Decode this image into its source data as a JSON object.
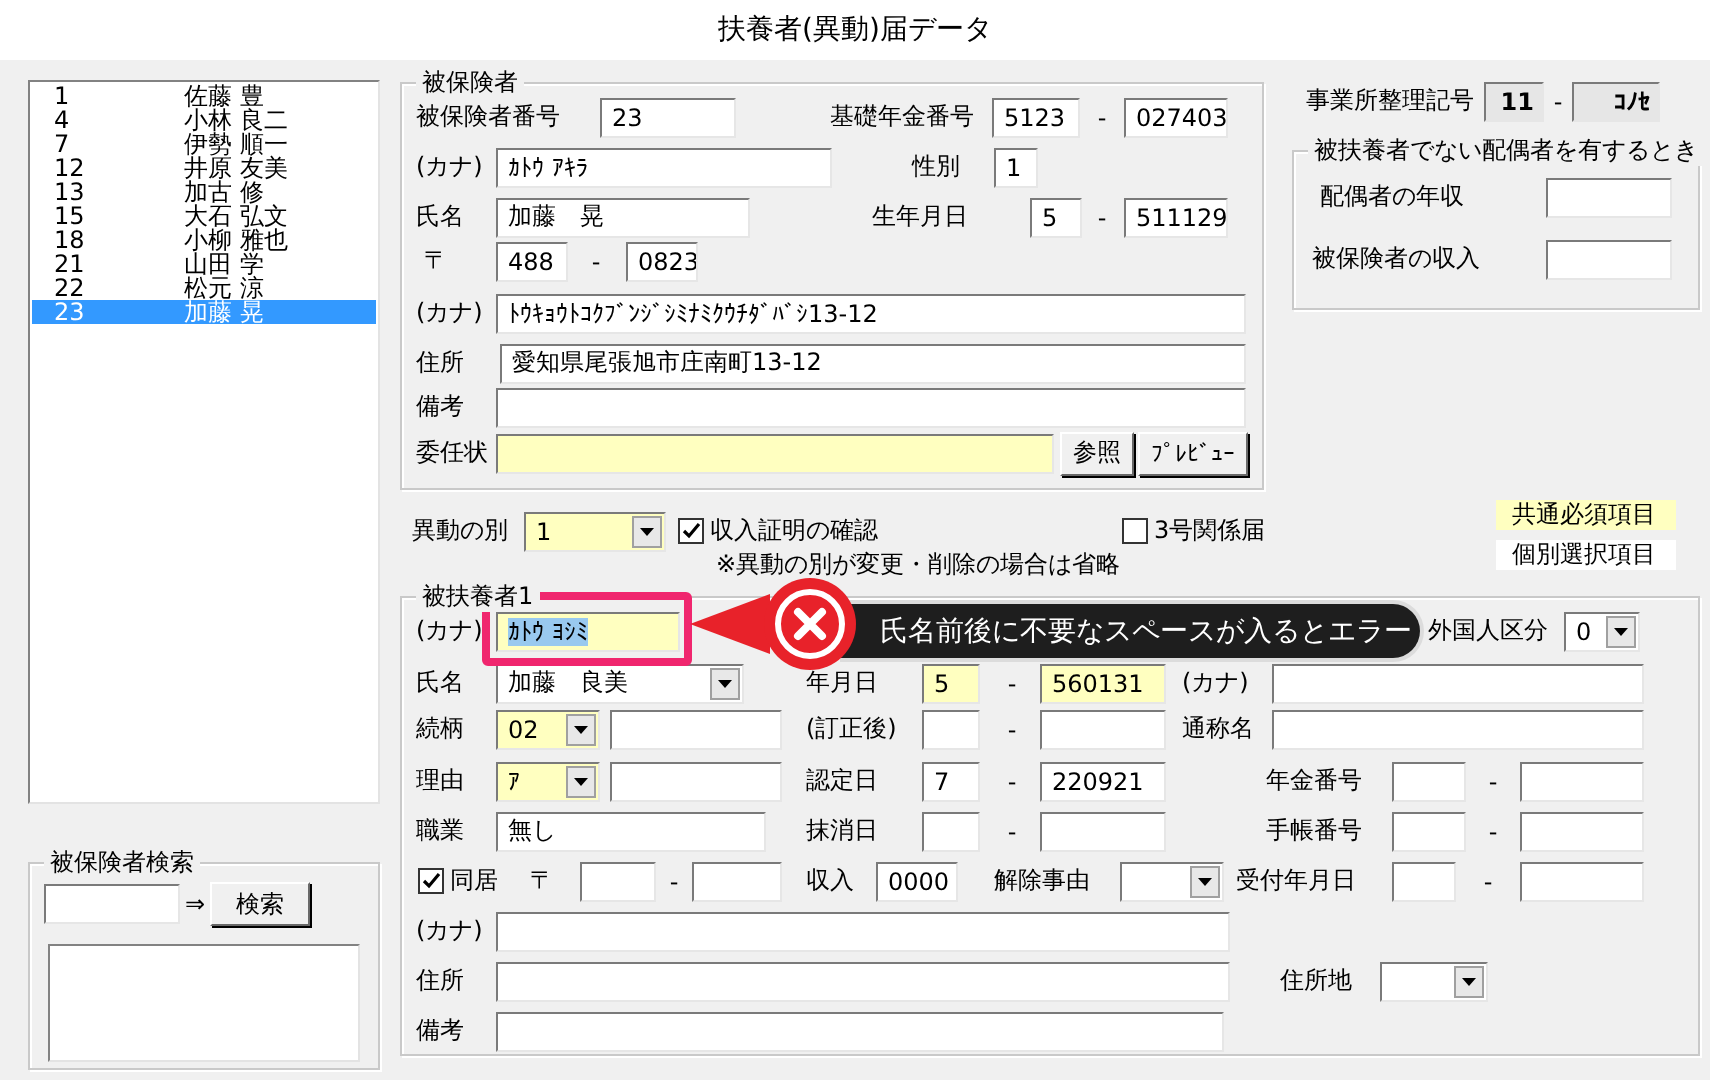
{
  "window": {
    "title": "扶養者(異動)届データ"
  },
  "insured_list": {
    "rows": [
      {
        "number": "1",
        "name": "佐藤 豊",
        "selected": false
      },
      {
        "number": "4",
        "name": "小林 良二",
        "selected": false
      },
      {
        "number": "7",
        "name": "伊勢 順一",
        "selected": false
      },
      {
        "number": "12",
        "name": "井原 友美",
        "selected": false
      },
      {
        "number": "13",
        "name": "加古 修",
        "selected": false
      },
      {
        "number": "15",
        "name": "大石 弘文",
        "selected": false
      },
      {
        "number": "18",
        "name": "小柳 雅也",
        "selected": false
      },
      {
        "number": "21",
        "name": "山田 学",
        "selected": false
      },
      {
        "number": "22",
        "name": "松元 涼",
        "selected": false
      },
      {
        "number": "23",
        "name": "加藤 晃",
        "selected": true
      }
    ]
  },
  "insured_search": {
    "title": "被保険者検索",
    "arrow": "⇒",
    "button": "検索"
  },
  "insured": {
    "title": "被保険者",
    "lines": [
      {
        "items": [
          {
            "kind": "label",
            "text": "被保険者番号"
          },
          {
            "kind": "field",
            "value": "23",
            "required": false
          },
          {
            "kind": "label",
            "text": "基礎年金番号"
          },
          {
            "kind": "field",
            "value": "5123",
            "required": false
          },
          {
            "kind": "sep",
            "text": "-"
          },
          {
            "kind": "field",
            "value": "027403",
            "required": false
          }
        ]
      },
      {
        "items": [
          {
            "kind": "label",
            "text": "(カナ)"
          },
          {
            "kind": "field",
            "value": "ｶﾄｳ ｱｷﾗ",
            "required": false
          },
          {
            "kind": "label",
            "text": "性別"
          },
          {
            "kind": "field",
            "value": "1",
            "required": false
          }
        ]
      },
      {
        "items": [
          {
            "kind": "label",
            "text": "氏名"
          },
          {
            "kind": "field",
            "value": "加藤　晃",
            "required": false
          },
          {
            "kind": "label",
            "text": "生年月日"
          },
          {
            "kind": "field",
            "value": "5",
            "required": false
          },
          {
            "kind": "sep",
            "text": "-"
          },
          {
            "kind": "field",
            "value": "511129",
            "required": false
          }
        ]
      },
      {
        "items": [
          {
            "kind": "label",
            "text": "〒"
          },
          {
            "kind": "field",
            "value": "488",
            "required": false
          },
          {
            "kind": "sep",
            "text": "-"
          },
          {
            "kind": "field",
            "value": "0823",
            "required": false
          }
        ]
      },
      {
        "items": [
          {
            "kind": "label",
            "text": "(カナ)"
          },
          {
            "kind": "field",
            "value": "ﾄｳｷｮｳﾄｺｸﾌﾞﾝｼﾞｼﾐﾅﾐｸｳﾁﾀﾞﾊﾞｼ13-12",
            "required": false
          }
        ]
      },
      {
        "items": [
          {
            "kind": "label",
            "text": "住所"
          },
          {
            "kind": "field",
            "value": "愛知県尾張旭市庄南町13-12",
            "required": false
          }
        ]
      },
      {
        "items": [
          {
            "kind": "label",
            "text": "備考"
          },
          {
            "kind": "field",
            "required": false
          }
        ]
      },
      {
        "items": [
          {
            "kind": "label",
            "text": "委任状"
          },
          {
            "kind": "field",
            "required": true
          },
          {
            "kind": "button",
            "label": "参照"
          },
          {
            "kind": "button",
            "label": "ﾌﾟﾚﾋﾞｭｰ"
          }
        ]
      }
    ]
  },
  "office": {
    "lines": [
      {
        "items": [
          {
            "kind": "label",
            "text": "事業所整理記号"
          },
          {
            "kind": "readonly",
            "value": "11"
          },
          {
            "kind": "sep",
            "text": "-"
          },
          {
            "kind": "readonly",
            "value": "ｺﾉｾ"
          }
        ]
      }
    ]
  },
  "spouse": {
    "title": "被扶養者でない配偶者を有するとき",
    "lines": [
      {
        "items": [
          {
            "kind": "label",
            "text": "配偶者の年収"
          },
          {
            "kind": "field",
            "required": false
          }
        ]
      },
      {
        "items": [
          {
            "kind": "label",
            "text": "被保険者の収入"
          },
          {
            "kind": "field",
            "required": false
          }
        ]
      }
    ]
  },
  "legend": [
    {
      "label": "共通必須項目",
      "required": true
    },
    {
      "label": "個別選択項目",
      "required": false
    }
  ],
  "change": {
    "lines": [
      {
        "items": [
          {
            "kind": "label",
            "text": "異動の別"
          },
          {
            "kind": "combo",
            "value": "1",
            "required": true
          },
          {
            "kind": "check",
            "label": "収入証明の確認",
            "checked": true
          },
          {
            "kind": "check",
            "label": "3号関係届",
            "checked": false
          }
        ]
      }
    ],
    "note": "※異動の別が変更・削除の場合は省略"
  },
  "dependent": {
    "title": "被扶養者1",
    "lines": [
      {
        "items": [
          {
            "kind": "label",
            "text": "(カナ)"
          },
          {
            "kind": "field",
            "value": "ｶﾄｳ ﾖｼﾐ",
            "required": true,
            "highlighted": true
          },
          {
            "kind": "label",
            "text": "外国人区分"
          },
          {
            "kind": "combo",
            "value": "0",
            "required": false
          }
        ]
      },
      {
        "items": [
          {
            "kind": "label",
            "text": "氏名"
          },
          {
            "kind": "combo",
            "value": "加藤　良美",
            "required": false
          },
          {
            "kind": "label",
            "text": "年月日"
          },
          {
            "kind": "field",
            "value": "5",
            "required": true
          },
          {
            "kind": "sep",
            "text": "-"
          },
          {
            "kind": "field",
            "value": "560131",
            "required": true
          },
          {
            "kind": "label",
            "text": "(カナ)"
          },
          {
            "kind": "field",
            "required": false
          }
        ]
      },
      {
        "items": [
          {
            "kind": "label",
            "text": "続柄"
          },
          {
            "kind": "combo",
            "value": "02",
            "required": true
          },
          {
            "kind": "field",
            "required": false
          },
          {
            "kind": "label",
            "text": "(訂正後)"
          },
          {
            "kind": "field",
            "required": false
          },
          {
            "kind": "sep",
            "text": "-"
          },
          {
            "kind": "field",
            "required": false
          },
          {
            "kind": "label",
            "text": "通称名"
          },
          {
            "kind": "field",
            "required": false
          }
        ]
      },
      {
        "items": [
          {
            "kind": "label",
            "text": "理由"
          },
          {
            "kind": "combo",
            "value": "ｱ",
            "required": true
          },
          {
            "kind": "field",
            "required": false
          },
          {
            "kind": "label",
            "text": "認定日"
          },
          {
            "kind": "field",
            "value": "7",
            "required": false
          },
          {
            "kind": "sep",
            "text": "-"
          },
          {
            "kind": "field",
            "value": "220921",
            "required": false
          },
          {
            "kind": "label",
            "text": "年金番号"
          },
          {
            "kind": "field",
            "required": false
          },
          {
            "kind": "sep",
            "text": "-"
          },
          {
            "kind": "field",
            "required": false
          }
        ]
      },
      {
        "items": [
          {
            "kind": "label",
            "text": "職業"
          },
          {
            "kind": "field",
            "value": "無し",
            "required": false
          },
          {
            "kind": "label",
            "text": "抹消日"
          },
          {
            "kind": "field",
            "required": false
          },
          {
            "kind": "sep",
            "text": "-"
          },
          {
            "kind": "field",
            "required": false
          },
          {
            "kind": "label",
            "text": "手帳番号"
          },
          {
            "kind": "field",
            "required": false
          },
          {
            "kind": "sep",
            "text": "-"
          },
          {
            "kind": "field",
            "required": false
          }
        ]
      },
      {
        "items": [
          {
            "kind": "check",
            "label": "同居",
            "checked": true
          },
          {
            "kind": "label",
            "text": "〒"
          },
          {
            "kind": "field",
            "required": false
          },
          {
            "kind": "sep",
            "text": "-"
          },
          {
            "kind": "field",
            "required": false
          },
          {
            "kind": "label",
            "text": "収入"
          },
          {
            "kind": "field",
            "value": "0000",
            "required": false
          },
          {
            "kind": "label",
            "text": "解除事由"
          },
          {
            "kind": "combo",
            "required": false
          },
          {
            "kind": "label",
            "text": "受付年月日"
          },
          {
            "kind": "field",
            "required": false
          },
          {
            "kind": "sep",
            "text": "-"
          },
          {
            "kind": "field",
            "required": false
          }
        ]
      },
      {
        "items": [
          {
            "kind": "label",
            "text": "(カナ)"
          },
          {
            "kind": "field",
            "required": false
          }
        ]
      },
      {
        "items": [
          {
            "kind": "label",
            "text": "住所"
          },
          {
            "kind": "field",
            "required": false
          },
          {
            "kind": "label",
            "text": "住所地"
          },
          {
            "kind": "combo",
            "required": false
          }
        ]
      },
      {
        "items": [
          {
            "kind": "label",
            "text": "備考"
          },
          {
            "kind": "field",
            "required": false
          }
        ]
      }
    ]
  },
  "error_tooltip": {
    "message": "氏名前後に不要なスペースが入るとエラー"
  }
}
